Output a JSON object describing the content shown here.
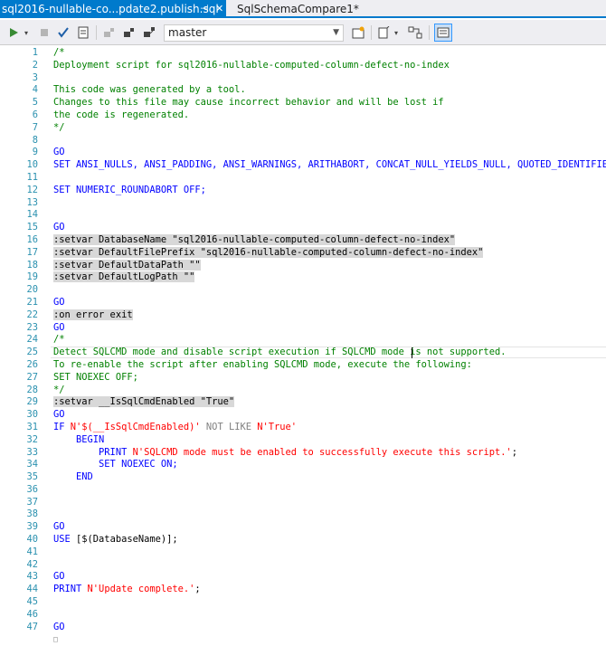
{
  "tabs": [
    {
      "label": "sql2016-nullable-co...pdate2.publish.sql",
      "active": true
    },
    {
      "label": "SqlSchemaCompare1*",
      "active": false
    }
  ],
  "toolbar": {
    "database": "master",
    "icons": [
      "execute-icon",
      "dropdown-arrow-icon",
      "stop-icon",
      "check-icon",
      "parse-icon",
      "disconnect-icon",
      "connect-icon",
      "change-connection-icon",
      "results-icon",
      "new-query-icon",
      "options-icon",
      "compare-icon",
      "sqlcmd-mode-icon"
    ]
  },
  "colors": {
    "accent": "#007acc",
    "comment": "#008000",
    "keyword": "#0000ff",
    "string": "#ff0000",
    "line_number": "#2b91af"
  },
  "code": [
    {
      "n": "1",
      "t": "c-comment",
      "text": "/*"
    },
    {
      "n": "2",
      "t": "c-comment",
      "text": "Deployment script for sql2016-nullable-computed-column-defect-no-index"
    },
    {
      "n": "3",
      "t": "c-normal",
      "text": ""
    },
    {
      "n": "4",
      "t": "c-comment",
      "text": "This code was generated by a tool."
    },
    {
      "n": "5",
      "t": "c-comment",
      "text": "Changes to this file may cause incorrect behavior and will be lost if"
    },
    {
      "n": "6",
      "t": "c-comment",
      "text": "the code is regenerated."
    },
    {
      "n": "7",
      "t": "c-comment",
      "text": "*/"
    },
    {
      "n": "8",
      "t": "c-normal",
      "text": ""
    },
    {
      "n": "9",
      "t": "c-keyword",
      "text": "GO"
    },
    {
      "n": "10",
      "t": "c-keyword",
      "text": "SET ANSI_NULLS, ANSI_PADDING, ANSI_WARNINGS, ARITHABORT, CONCAT_NULL_YIELDS_NULL, QUOTED_IDENTIFIER ON;"
    },
    {
      "n": "11",
      "t": "c-normal",
      "text": ""
    },
    {
      "n": "12",
      "t": "c-keyword",
      "text": "SET NUMERIC_ROUNDABORT OFF;"
    },
    {
      "n": "13",
      "t": "c-normal",
      "text": ""
    },
    {
      "n": "14",
      "t": "c-normal",
      "text": ""
    },
    {
      "n": "15",
      "t": "c-keyword",
      "text": "GO"
    },
    {
      "n": "16",
      "t": "c-directive",
      "text": ":setvar DatabaseName \"sql2016-nullable-computed-column-defect-no-index\""
    },
    {
      "n": "17",
      "t": "c-directive",
      "text": ":setvar DefaultFilePrefix \"sql2016-nullable-computed-column-defect-no-index\""
    },
    {
      "n": "18",
      "t": "c-directive",
      "text": ":setvar DefaultDataPath \"\""
    },
    {
      "n": "19",
      "t": "c-directive",
      "text": ":setvar DefaultLogPath \"\""
    },
    {
      "n": "20",
      "t": "c-normal",
      "text": ""
    },
    {
      "n": "21",
      "t": "c-keyword",
      "text": "GO"
    },
    {
      "n": "22",
      "t": "c-directive",
      "text": ":on error exit"
    },
    {
      "n": "23",
      "t": "c-keyword",
      "text": "GO"
    },
    {
      "n": "24",
      "t": "c-comment",
      "text": "/*"
    },
    {
      "n": "25",
      "t": "c-comment",
      "text": "Detect SQLCMD mode and disable script execution if SQLCMD mode is not supported."
    },
    {
      "n": "26",
      "t": "c-comment",
      "text": "To re-enable the script after enabling SQLCMD mode, execute the following:"
    },
    {
      "n": "27",
      "t": "c-comment",
      "text": "SET NOEXEC OFF;"
    },
    {
      "n": "28",
      "t": "c-comment",
      "text": "*/"
    },
    {
      "n": "29",
      "t": "c-directive",
      "text": ":setvar __IsSqlCmdEnabled \"True\""
    },
    {
      "n": "30",
      "t": "c-keyword",
      "text": "GO"
    },
    {
      "n": "31",
      "t": "mixed",
      "parts": [
        [
          "c-keyword",
          "IF "
        ],
        [
          "c-string",
          "N'$(__IsSqlCmdEnabled)'"
        ],
        [
          "c-gray",
          " NOT LIKE "
        ],
        [
          "c-string",
          "N'True'"
        ]
      ]
    },
    {
      "n": "32",
      "t": "c-keyword",
      "text": "    BEGIN"
    },
    {
      "n": "33",
      "t": "mixed",
      "parts": [
        [
          "c-keyword",
          "        PRINT "
        ],
        [
          "c-string",
          "N'SQLCMD mode must be enabled to successfully execute this script.'"
        ],
        [
          "c-normal",
          ";"
        ]
      ]
    },
    {
      "n": "34",
      "t": "c-keyword",
      "text": "        SET NOEXEC ON;"
    },
    {
      "n": "35",
      "t": "c-keyword",
      "text": "    END"
    },
    {
      "n": "36",
      "t": "c-normal",
      "text": ""
    },
    {
      "n": "37",
      "t": "c-normal",
      "text": ""
    },
    {
      "n": "38",
      "t": "c-normal",
      "text": ""
    },
    {
      "n": "39",
      "t": "c-keyword",
      "text": "GO"
    },
    {
      "n": "40",
      "t": "mixed",
      "parts": [
        [
          "c-keyword",
          "USE "
        ],
        [
          "c-normal",
          "[$(DatabaseName)];"
        ]
      ]
    },
    {
      "n": "41",
      "t": "c-normal",
      "text": ""
    },
    {
      "n": "42",
      "t": "c-normal",
      "text": ""
    },
    {
      "n": "43",
      "t": "c-keyword",
      "text": "GO"
    },
    {
      "n": "44",
      "t": "mixed",
      "parts": [
        [
          "c-keyword",
          "PRINT "
        ],
        [
          "c-string",
          "N'Update complete.'"
        ],
        [
          "c-normal",
          ";"
        ]
      ]
    },
    {
      "n": "45",
      "t": "c-normal",
      "text": ""
    },
    {
      "n": "46",
      "t": "c-normal",
      "text": ""
    },
    {
      "n": "47",
      "t": "c-keyword",
      "text": "GO"
    },
    {
      "n": "48",
      "t": "c-gray",
      "text": "□"
    }
  ]
}
